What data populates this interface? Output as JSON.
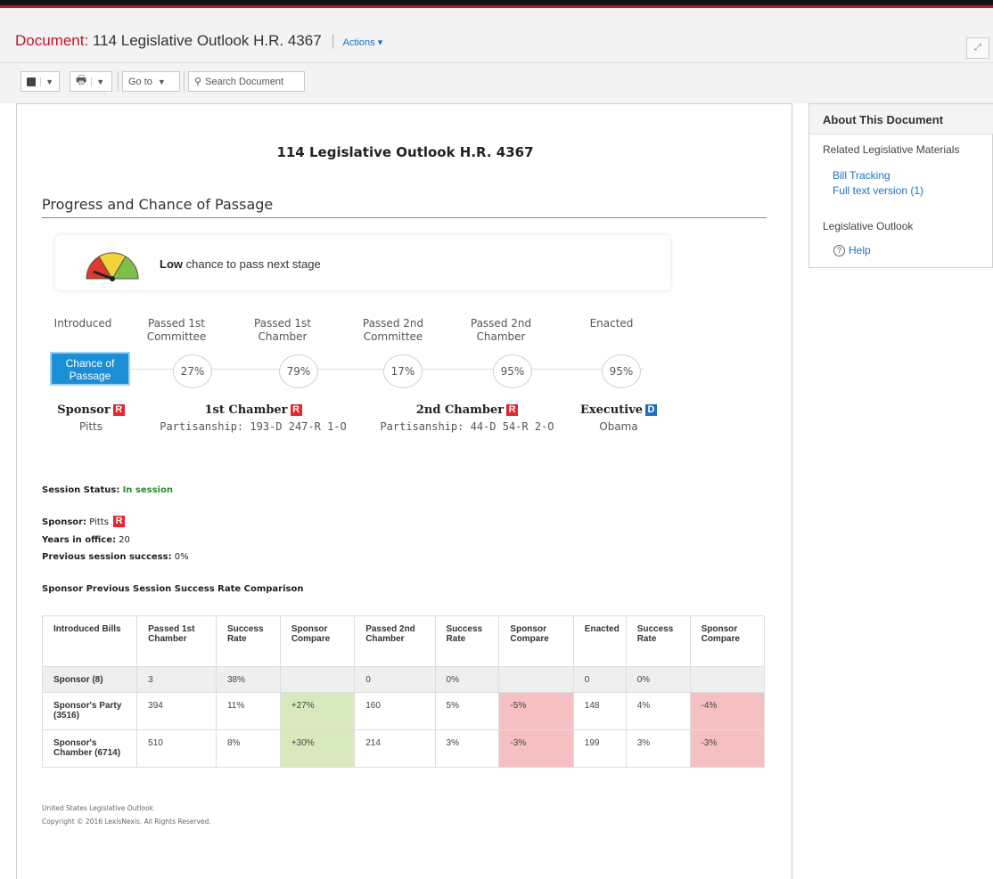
{
  "header": {
    "doc_label": "Document:",
    "doc_title": "114 Legislative Outlook H.R. 4367",
    "actions_label": "Actions ▾",
    "expand_icon": "expand-icon"
  },
  "toolbar": {
    "folder_icon": "folder-icon",
    "print_icon": "print-icon",
    "goto_label": "Go to",
    "search_label": "Search Document"
  },
  "page": {
    "title": "114 Legislative Outlook H.R. 4367",
    "section_title": "Progress and Chance of Passage",
    "chance_level": "Low",
    "chance_text": "chance to pass next stage",
    "chance_button": "Chance of Passage",
    "stages": [
      {
        "label": "Introduced",
        "pct": ""
      },
      {
        "label": "Passed 1st Committee",
        "pct": "27%"
      },
      {
        "label": "Passed 1st Chamber",
        "pct": "79%"
      },
      {
        "label": "Passed 2nd Committee",
        "pct": "17%"
      },
      {
        "label": "Passed 2nd Chamber",
        "pct": "95%"
      },
      {
        "label": "Enacted",
        "pct": "95%"
      }
    ],
    "sponsor_head": "Sponsor",
    "sponsor_name": "Pitts",
    "sponsor_party": "R",
    "chamber1_head": "1st Chamber",
    "chamber1_party": "R",
    "chamber1_val": "Partisanship: 193-D 247-R 1-O",
    "chamber2_head": "2nd Chamber",
    "chamber2_party": "R",
    "chamber2_val": "Partisanship: 44-D 54-R 2-O",
    "exec_head": "Executive",
    "exec_party": "D",
    "exec_name": "Obama",
    "session_label": "Session Status:",
    "session_value": "In session",
    "sponsor_label": "Sponsor:",
    "sponsor_value": "Pitts",
    "years_label": "Years in office:",
    "years_value": "20",
    "prev_label": "Previous session success:",
    "prev_value": "0%",
    "table_title": "Sponsor Previous Session Success Rate Comparison",
    "table": {
      "headers": [
        "Introduced Bills",
        "Passed 1st Chamber",
        "Success Rate",
        "Sponsor Compare",
        "Passed 2nd Chamber",
        "Success Rate",
        "Sponsor Compare",
        "Enacted",
        "Success Rate",
        "Sponsor Compare"
      ],
      "rows": [
        [
          "Sponsor (8)",
          "3",
          "38%",
          "",
          "0",
          "0%",
          "",
          "0",
          "0%",
          ""
        ],
        [
          "Sponsor's Party (3516)",
          "394",
          "11%",
          "+27%",
          "160",
          "5%",
          "-5%",
          "148",
          "4%",
          "-4%"
        ],
        [
          "Sponsor's Chamber (6714)",
          "510",
          "8%",
          "+30%",
          "214",
          "3%",
          "-3%",
          "199",
          "3%",
          "-3%"
        ]
      ]
    },
    "footer_line1": "United States Legislative Outlook",
    "footer_line2": "Copyright © 2016 LexisNexis. All Rights Reserved."
  },
  "side": {
    "title": "About This Document",
    "related_label": "Related Legislative Materials",
    "link_bill_tracking": "Bill Tracking",
    "link_full_text": "Full text version (1)",
    "outlook_label": "Legislative Outlook",
    "help_label": "Help",
    "help_icon": "help-icon"
  },
  "colors": {
    "brand_red": "#c8102e",
    "link_blue": "#1a73c8",
    "chance_blue": "#1a8fd6",
    "positive": "#d8e9be",
    "negative": "#f6bfc1"
  }
}
